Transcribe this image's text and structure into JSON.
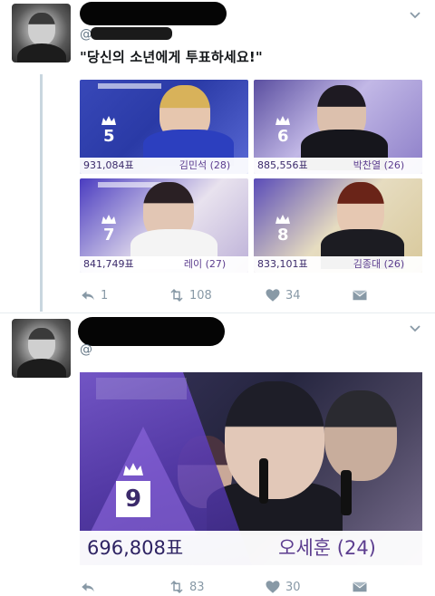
{
  "tweet1": {
    "handle_prefix": "@",
    "text": "\"당신의 소년에게 투표하세요!\"",
    "cards": [
      {
        "rank": "5",
        "votes": "931,084표",
        "name": "김민석 (28)"
      },
      {
        "rank": "6",
        "votes": "885,556표",
        "name": "박찬열 (26)"
      },
      {
        "rank": "7",
        "votes": "841,749표",
        "name": "레이 (27)"
      },
      {
        "rank": "8",
        "votes": "833,101표",
        "name": "김종대 (26)"
      }
    ],
    "actions": {
      "reply_count": "1",
      "retweet_count": "108",
      "like_count": "34"
    }
  },
  "tweet2": {
    "handle_prefix": "@",
    "card": {
      "rank": "9",
      "votes": "696,808표",
      "name": "오세훈 (24)"
    },
    "actions": {
      "reply_count": "",
      "retweet_count": "83",
      "like_count": "30"
    }
  },
  "icons": {
    "reply": "reply-icon",
    "retweet": "retweet-icon",
    "like": "heart-icon",
    "dm": "dm-icon",
    "more": "chevron-down-icon"
  },
  "colors": {
    "muted": "#8899a6",
    "thread": "#c9d6df",
    "card_purple": "#6b4fc8",
    "name_purple": "#5c3d8f"
  }
}
